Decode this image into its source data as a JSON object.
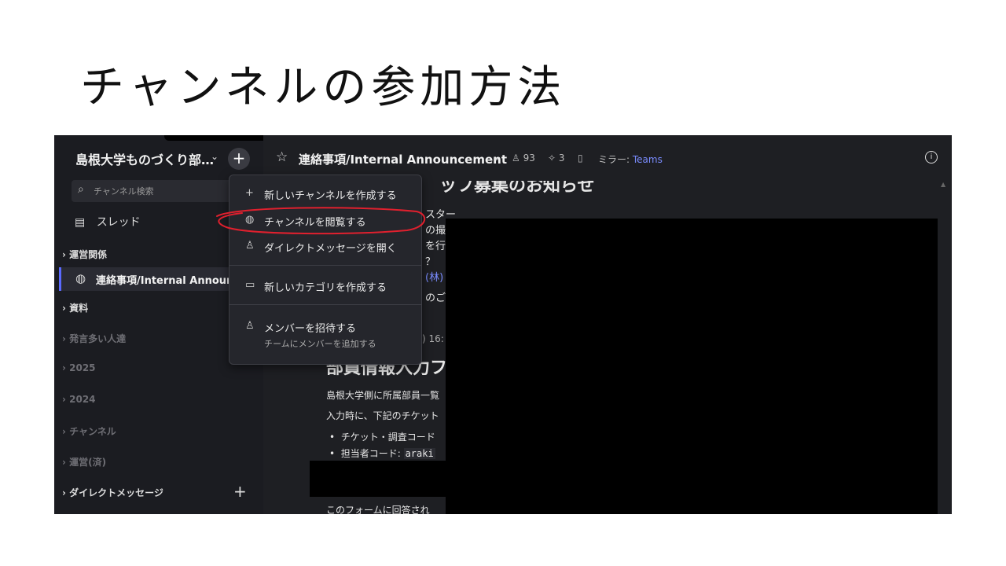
{
  "slide": {
    "title": "チャンネルの参加方法"
  },
  "sidebar": {
    "team_name": "島根大学ものづくり部…",
    "team_chevron": "⌄",
    "add_button": "+",
    "search_placeholder": "チャンネル検索",
    "threads_label": "スレッド",
    "sections": [
      {
        "label": "運営関係"
      },
      {
        "label": "資料"
      },
      {
        "label": "発言多い人達"
      },
      {
        "label": "2025"
      },
      {
        "label": "2024"
      },
      {
        "label": "チャンネル"
      },
      {
        "label": "運営(済)"
      },
      {
        "label": "ダイレクトメッセージ"
      }
    ],
    "active_channel": "連絡事項/Internal Announc",
    "dm_add": "+"
  },
  "header": {
    "channel_title": "連絡事項/Internal Announcement",
    "members": "93",
    "pins": "3",
    "mirror_label": "ミラー:",
    "mirror_target": "Teams"
  },
  "content": {
    "fragments": [
      "ッフ募集のお知らせ",
      "スター",
      "の撮影",
      "を行い",
      "？",
      "(林)",
      "のご案",
      ") 16:",
      "部員情報入力フ",
      "島根大学側に所属部員一覧",
      "入力時に、下記のチケット",
      "チケット・調査コード",
      "担当者コード: ",
      "araki",
      "このフォームに回答され"
    ]
  },
  "menu": {
    "items": [
      {
        "icon": "plus-icon",
        "glyph": "+",
        "label": "新しいチャンネルを作成する"
      },
      {
        "icon": "globe-icon",
        "glyph": "◍",
        "label": "チャンネルを閲覧する"
      },
      {
        "icon": "person-icon",
        "glyph": "♙",
        "label": "ダイレクトメッセージを開く"
      },
      {
        "icon": "folder-plus-icon",
        "glyph": "▭",
        "label": "新しいカテゴリを作成する"
      },
      {
        "icon": "person-add-icon",
        "glyph": "♙",
        "label": "メンバーを招待する",
        "sub": "チームにメンバーを追加する"
      }
    ]
  },
  "colors": {
    "accent": "#5b6aff",
    "link": "#7a8cff",
    "annotation": "#e0202e",
    "background": "#1e1f23"
  }
}
